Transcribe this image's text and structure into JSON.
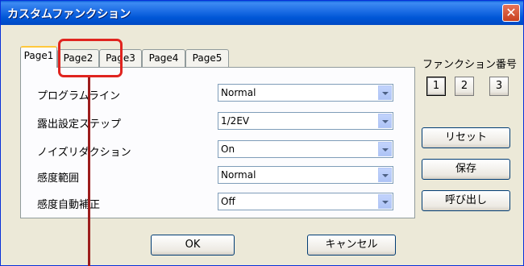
{
  "window": {
    "title": "カスタムファンクション",
    "close_label": "✕"
  },
  "tabs": [
    {
      "label": "Page1",
      "active": true
    },
    {
      "label": "Page2",
      "active": false
    },
    {
      "label": "Page3",
      "active": false
    },
    {
      "label": "Page4",
      "active": false
    },
    {
      "label": "Page5",
      "active": false
    }
  ],
  "settings": [
    {
      "label": "プログラムライン",
      "value": "Normal"
    },
    {
      "label": "露出設定ステップ",
      "value": "1/2EV"
    },
    {
      "label": "ノイズリダクション",
      "value": "On"
    },
    {
      "label": "感度範囲",
      "value": "Normal"
    },
    {
      "label": "感度自動補正",
      "value": "Off"
    }
  ],
  "function_number": {
    "label": "ファンクション番号",
    "options": [
      "1",
      "2",
      "3"
    ],
    "selected": "1"
  },
  "side_buttons": {
    "reset": "リセット",
    "save": "保存",
    "load": "呼び出し"
  },
  "footer": {
    "ok": "OK",
    "cancel": "キャンセル"
  },
  "colors": {
    "highlight": "#e0241f",
    "pointer": "#9c1d1d"
  }
}
